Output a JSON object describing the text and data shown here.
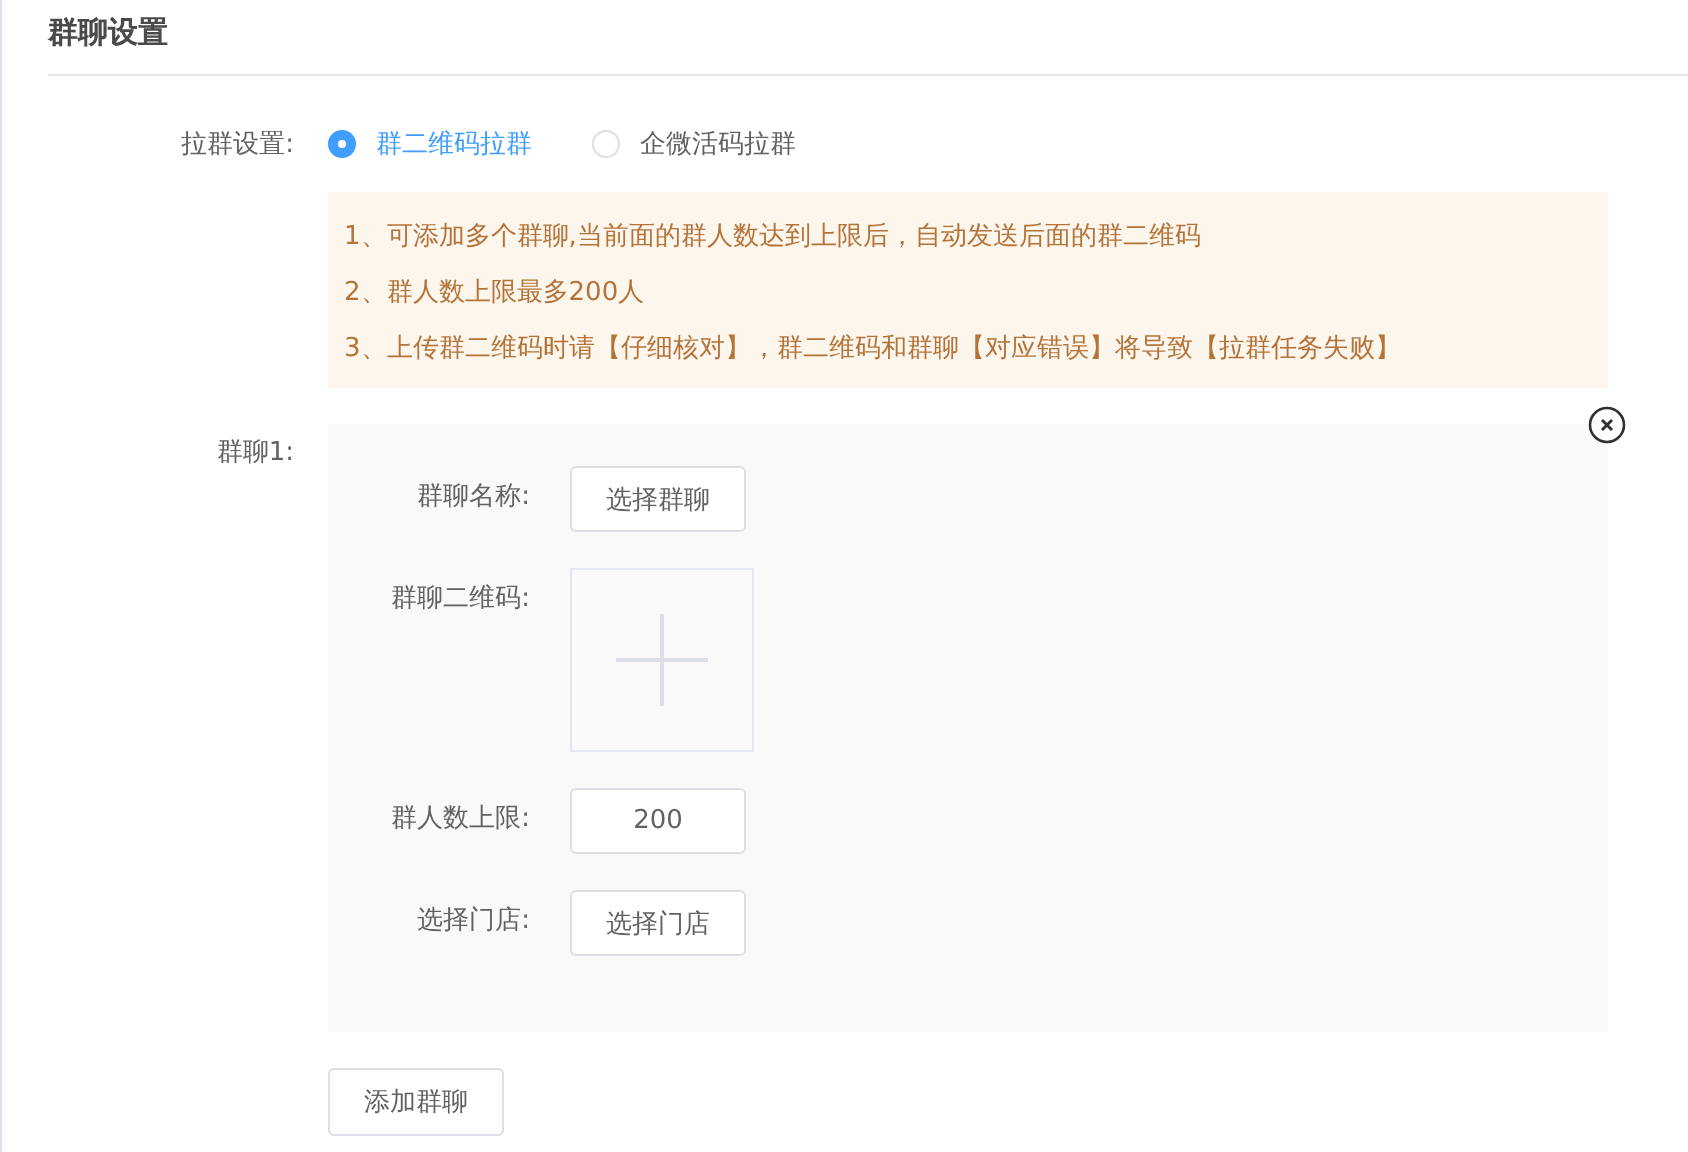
{
  "page": {
    "title": "群聊设置"
  },
  "invite_setting": {
    "label": "拉群设置:",
    "options": [
      {
        "label": "群二维码拉群",
        "selected": true
      },
      {
        "label": "企微活码拉群",
        "selected": false
      }
    ]
  },
  "notice": [
    "1、可添加多个群聊,当前面的群人数达到上限后，自动发送后面的群二维码",
    "2、群人数上限最多200人",
    "3、上传群二维码时请【仔细核对】，群二维码和群聊【对应错误】将导致【拉群任务失败】"
  ],
  "groups": [
    {
      "label": "群聊1:",
      "fields": [
        {
          "kind": "button",
          "label": "群聊名称:",
          "value": "选择群聊"
        },
        {
          "kind": "upload",
          "label": "群聊二维码:"
        },
        {
          "kind": "input",
          "label": "群人数上限:",
          "value": "200"
        },
        {
          "kind": "button",
          "label": "选择门店:",
          "value": "选择门店"
        }
      ]
    }
  ],
  "add_button": "添加群聊"
}
